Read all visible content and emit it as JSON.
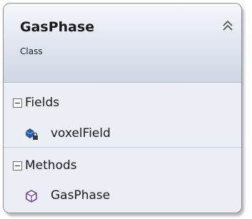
{
  "class": {
    "name": "GasPhase",
    "stereotype": "Class"
  },
  "sections": [
    {
      "label": "Fields",
      "members": [
        {
          "name": "voxelField",
          "icon": "field-private-icon"
        }
      ]
    },
    {
      "label": "Methods",
      "members": [
        {
          "name": "GasPhase",
          "icon": "method-icon"
        }
      ]
    }
  ],
  "colors": {
    "header_top": "#f6f7fb",
    "header_bottom": "#cfd6e4",
    "section_band": "#ebeef5",
    "border": "#8c8c8c",
    "field_icon": "#2b5fa8",
    "method_icon": "#7a3fb0"
  }
}
